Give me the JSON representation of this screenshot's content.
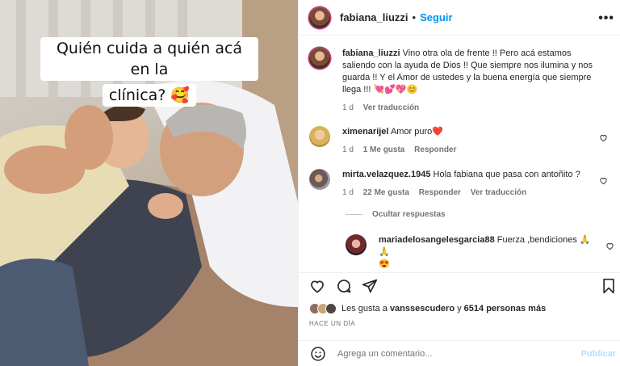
{
  "photo": {
    "caption_line1": "Quién cuida a quién acá en la",
    "caption_line2": "clínica? 🥰"
  },
  "header": {
    "username": "fabiana_liuzzi",
    "separator": "•",
    "follow_label": "Seguir",
    "more_label": "•••"
  },
  "post": {
    "author": "fabiana_liuzzi",
    "text": "Vino otra ola de frente !! Pero acá estamos saliendo con la ayuda de Dios !! Que siempre nos ilumina y nos guarda !! Y el Amor de ustedes y la buena energía que siempre llega !!! 💘💕💖😊",
    "time": "1 d",
    "translate_label": "Ver traducción"
  },
  "comments": [
    {
      "user": "ximenarijel",
      "text": "Amor puro❤️",
      "time": "1 d",
      "likes": "1 Me gusta",
      "reply_label": "Responder"
    },
    {
      "user": "mirta.velazquez.1945",
      "text": "Hola fabiana que pasa con antoñito ?",
      "time": "1 d",
      "likes": "22 Me gusta",
      "reply_label": "Responder",
      "translate_label": "Ver traducción"
    }
  ],
  "hide_replies_label": "Ocultar respuestas",
  "reply": {
    "user": "mariadelosangelesgarcia88",
    "text": "Fuerza ,bendiciones 🙏 🙏",
    "emoji_line": "😍"
  },
  "likes": {
    "prefix": "Les gusta a",
    "user": "vanssescudero",
    "connector": "y",
    "others": "6514 personas más"
  },
  "posted_when": "HACE UN DÍA",
  "add_comment": {
    "placeholder": "Agrega un comentario...",
    "publish_label": "Publicar"
  },
  "colors": {
    "accent": "#0095f6",
    "accent_disabled": "#b2dffc",
    "heart_red": "#e0245e",
    "muted": "#737373"
  },
  "icons": [
    "smile-icon",
    "heart-icon",
    "comment-icon",
    "share-icon",
    "bookmark-icon",
    "more-icon"
  ]
}
